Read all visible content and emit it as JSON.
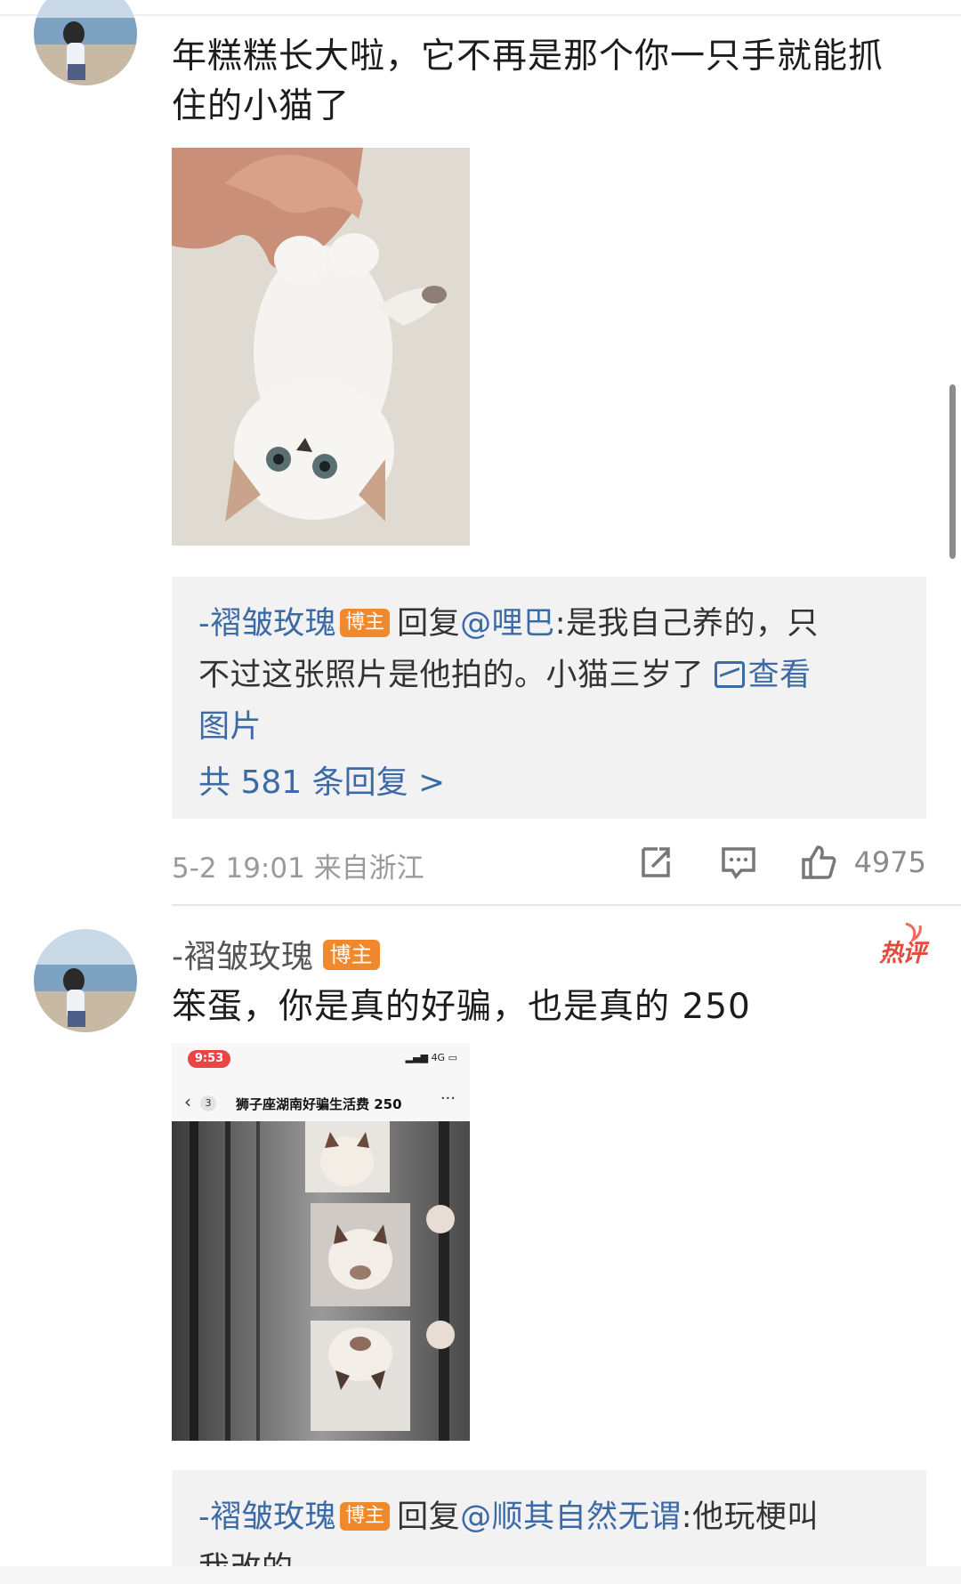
{
  "prev_comment": {
    "like_count": "4975",
    "time": "5-2 19:01",
    "location": "来自浙江",
    "text": "年糕糕长大啦，它不再是那个你一只手就能抓住的小猫了",
    "text_line1": "年糕糕长大啦，它不再是那个你一只手就能抓",
    "text_line2": "住的小猫了",
    "reply_preview": {
      "author": "-褶皱玫瑰",
      "author_badge": "博主",
      "reply_word": "回复",
      "mention": "@哩巴",
      "content_line1": ":是我自己养的，只",
      "content_line2": "不过这张照片是他拍的。小猫三岁了 ",
      "view_picture_a": "查看",
      "view_picture_b": "图片",
      "total_replies": "共 581 条回复 >"
    }
  },
  "comment": {
    "author": "-褶皱玫瑰",
    "author_badge": "博主",
    "hot_tag": "热评",
    "text": "笨蛋，你是真的好骗，也是真的 250",
    "screenshot": {
      "status_time": "9:53",
      "signal": "4G",
      "nav_count": "3",
      "nav_title": "狮子座湖南好骗生活费 250",
      "more": "···"
    },
    "reply_preview": {
      "author": "-褶皱玫瑰",
      "author_badge": "博主",
      "reply_word": "回复",
      "mention": "@顺其自然无谓",
      "content_line1": ":他玩梗叫",
      "content_line2_partial": "我改的"
    }
  },
  "icons": {
    "share": "share-icon",
    "comment": "comment-icon",
    "like": "thumbs-up-icon",
    "picture": "picture-icon"
  },
  "colors": {
    "link": "#3b6aa7",
    "badge": "#f0892c",
    "hot": "#e24a3a",
    "reply_bg": "#f2f2f2"
  }
}
